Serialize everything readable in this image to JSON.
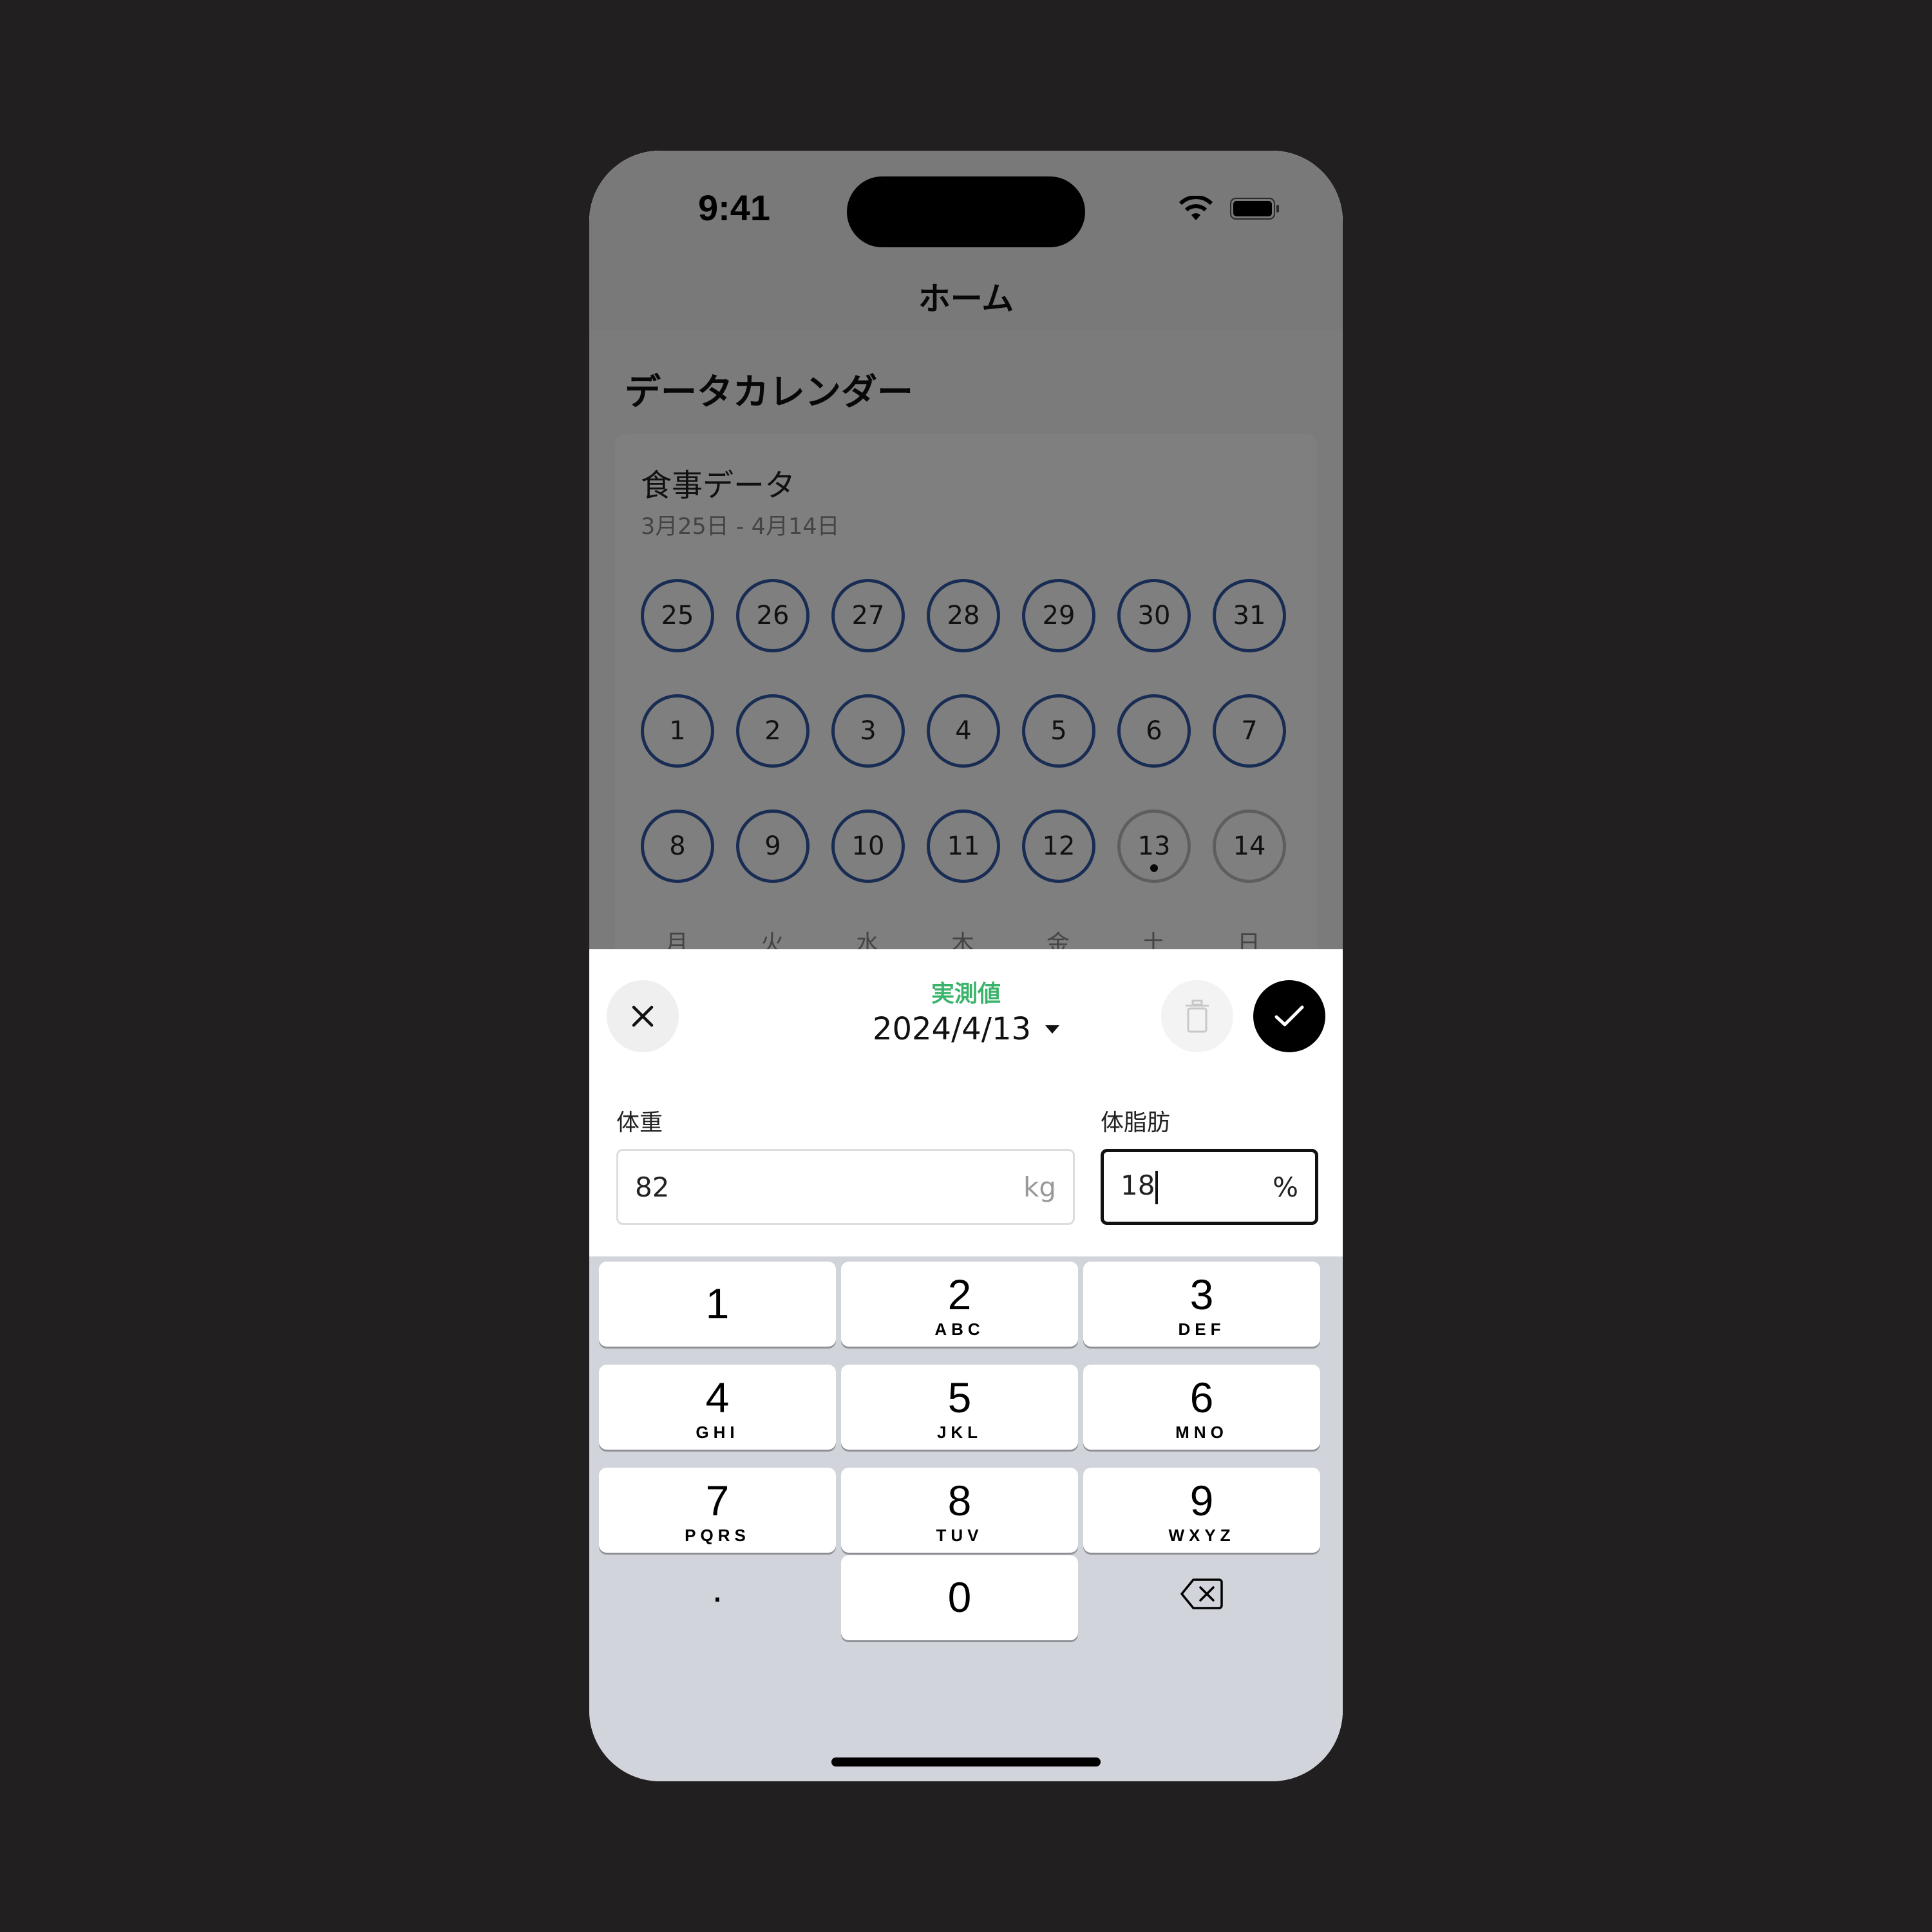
{
  "status_bar": {
    "time": "9:41"
  },
  "nav": {
    "title": "ホーム"
  },
  "section": {
    "title": "データカレンダー"
  },
  "card": {
    "title": "食事データ",
    "range": "3月25日 - 4月14日",
    "weeks": [
      [
        "25",
        "26",
        "27",
        "28",
        "29",
        "30",
        "31"
      ],
      [
        "1",
        "2",
        "3",
        "4",
        "5",
        "6",
        "7"
      ],
      [
        "8",
        "9",
        "10",
        "11",
        "12",
        "13",
        "14"
      ]
    ],
    "weekdays": [
      "月",
      "火",
      "水",
      "木",
      "金",
      "土",
      "日"
    ],
    "today": "13"
  },
  "sheet": {
    "mode_label": "実測値",
    "date": "2024/4/13",
    "weight": {
      "label": "体重",
      "value": "82",
      "unit": "kg"
    },
    "body_fat": {
      "label": "体脂肪",
      "value": "18",
      "unit": "%"
    }
  },
  "keypad": {
    "keys": [
      {
        "num": "1",
        "letters": ""
      },
      {
        "num": "2",
        "letters": "ABC"
      },
      {
        "num": "3",
        "letters": "DEF"
      },
      {
        "num": "4",
        "letters": "GHI"
      },
      {
        "num": "5",
        "letters": "JKL"
      },
      {
        "num": "6",
        "letters": "MNO"
      },
      {
        "num": "7",
        "letters": "PQRS"
      },
      {
        "num": "8",
        "letters": "TUV"
      },
      {
        "num": "9",
        "letters": "WXYZ"
      }
    ],
    "decimal": ".",
    "zero": "0"
  },
  "colors": {
    "accent_green": "#3bb36b",
    "ring_blue": "#3359a6"
  },
  "icons": {
    "close": "close-icon",
    "delete": "trash-icon",
    "confirm": "check-icon",
    "backspace": "backspace-icon"
  }
}
